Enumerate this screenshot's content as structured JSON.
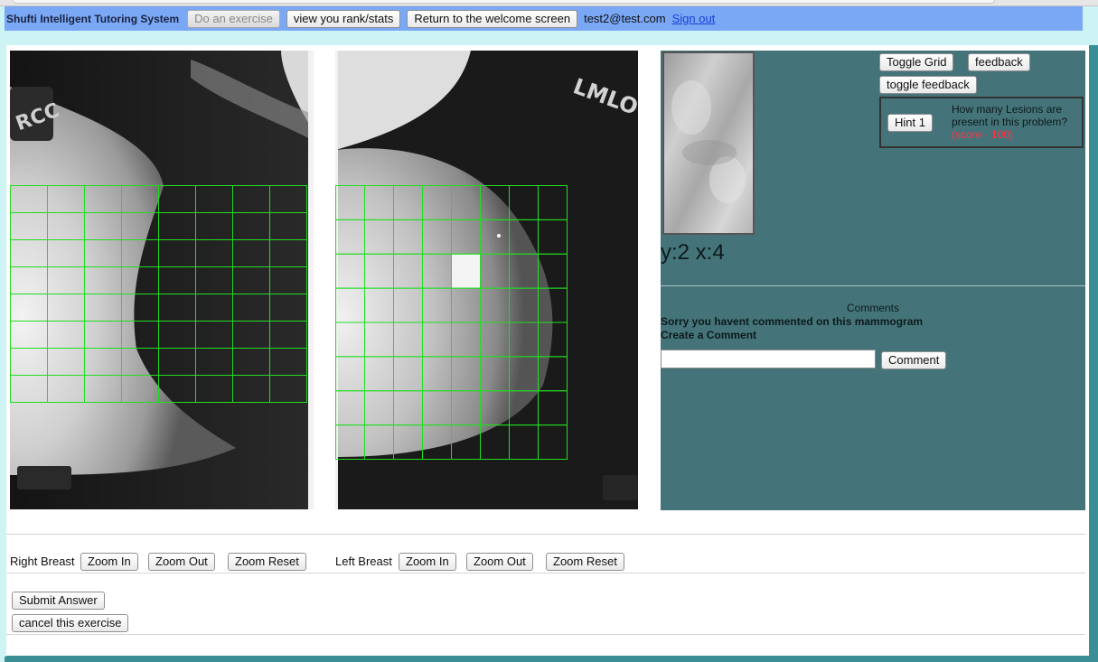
{
  "nav": {
    "brand": "Shufti Intelligent Tutoring System",
    "do_exercise": "Do an exercise",
    "rank_stats": "view you rank/stats",
    "welcome": "Return to the welcome screen",
    "user_email": "test2@test.com",
    "sign_out": "Sign out"
  },
  "viewer": {
    "right_breast_marker": "RCC",
    "left_breast_marker": "LMLO",
    "grid_color": "#22dd22",
    "right_grid": {
      "rows": 8,
      "cols": 8
    },
    "left_grid": {
      "rows": 8,
      "cols": 8
    }
  },
  "side": {
    "toggle_grid": "Toggle Grid",
    "feedback": "feedback",
    "toggle_feedback": "toggle feedback",
    "hint_button": "Hint 1",
    "hint_question": "How many Lesions are present in this problem?",
    "hint_score": "(score - 100)",
    "coords": "y:2 x:4",
    "comments_title": "Comments",
    "no_comment": "Sorry you havent commented on this mammogram",
    "create_comment": "Create a Comment",
    "comment_input_value": "",
    "comment_button": "Comment"
  },
  "controls": {
    "right_label": "Right Breast",
    "left_label": "Left Breast",
    "zoom_in": "Zoom In",
    "zoom_out": "Zoom Out",
    "zoom_reset": "Zoom Reset",
    "submit": "Submit Answer",
    "cancel": "cancel this exercise"
  },
  "colors": {
    "nav_bar": "#7aa8f5",
    "side_panel": "#447479",
    "page_bg": "#cdf3f5",
    "accent_teal": "#3a8f95",
    "score_red": "#ff3344",
    "link_blue": "#1a3fd6"
  }
}
